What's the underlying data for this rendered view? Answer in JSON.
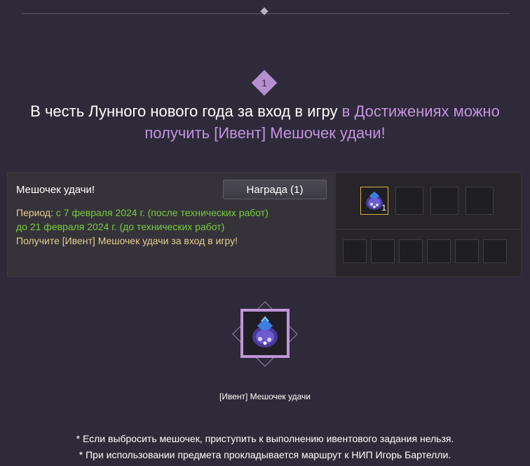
{
  "step": {
    "number": "1"
  },
  "headline": {
    "part_white": "В честь Лунного нового года за вход в игру",
    "part_purple_1": "в Достижениях можно",
    "part_purple_2": "получить [Ивент] Мешочек удачи!"
  },
  "event": {
    "title": "Мешочек удачи!",
    "reward_button": "Награда (1)",
    "period_label": "Период:",
    "period_value_1": "с 7 февраля 2024 г. (после технических работ)",
    "period_value_2": "до 21 февраля 2024 г. (до технических работ)",
    "instruction": "Получите [Ивент] Мешочек удачи за вход в игру!"
  },
  "reward_slots": {
    "first_count": "1",
    "top_row_count": 4,
    "bottom_row_count": 6
  },
  "item": {
    "name": "[Ивент] Мешочек удачи",
    "icon": "luck-pouch-icon"
  },
  "notes": [
    "* Если выбросить мешочек, приступить к выполнению ивентового задания нельзя.",
    "* При использовании предмета прокладывается маршрут к НИП Игорь Бартелли."
  ],
  "colors": {
    "background": "#2e2a39",
    "accent_purple": "#c493e0",
    "period_green": "#78cc3f",
    "text_yellow": "#e6cf8d",
    "slot_highlight": "#d9b24a"
  }
}
